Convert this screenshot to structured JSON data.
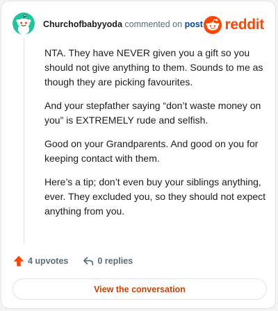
{
  "header": {
    "username": "Churchofbabyyoda",
    "action_text": "commented on",
    "post_link": "post",
    "brand_name": "reddit",
    "brand_color": "#ff4500",
    "avatar_color": "#21c59b"
  },
  "comment": {
    "paragraphs": [
      "NTA. They have NEVER given you a gift so you should not give anything to them. Sounds to me as though they are picking favourites.",
      "And your stepfather saying “don’t waste money on you” is EXTREMELY rude and selfish.",
      "Good on your Grandparents. And good on you for keeping contact with them.",
      "Here’s a tip; don’t even buy your siblings anything, ever. They excluded you, so they should not expect anything from you."
    ]
  },
  "actions": {
    "upvotes_label": "4 upvotes",
    "upvote_icon": "arrow-up-icon",
    "upvote_color": "#ff4500",
    "replies_label": "0 replies",
    "reply_icon": "reply-arrow-icon"
  },
  "cta": {
    "label": "View the conversation",
    "color": "#cc3f00"
  }
}
